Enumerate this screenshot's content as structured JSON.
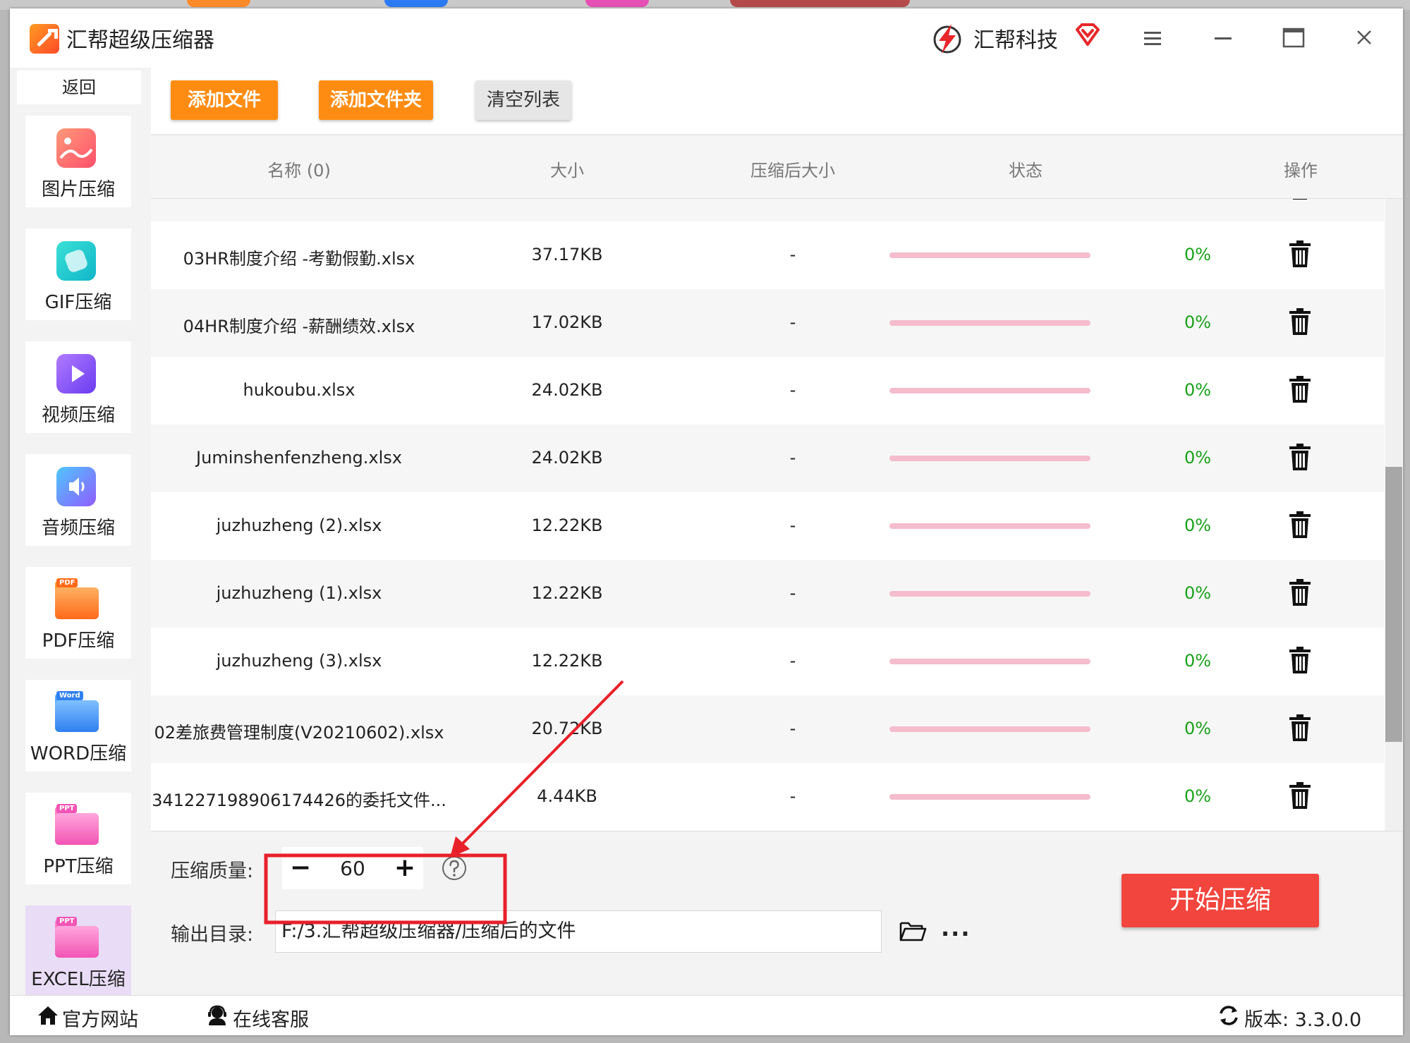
{
  "app": {
    "title": "汇帮超级压缩器",
    "brand_name": "汇帮科技"
  },
  "sidebar": {
    "back_label": "返回",
    "items": [
      {
        "label": "图片压缩",
        "icon": "image-icon"
      },
      {
        "label": "GIF压缩",
        "icon": "gif-icon"
      },
      {
        "label": "视频压缩",
        "icon": "video-icon"
      },
      {
        "label": "音频压缩",
        "icon": "audio-icon"
      },
      {
        "label": "PDF压缩",
        "icon": "pdf-icon",
        "tag": "PDF"
      },
      {
        "label": "WORD压缩",
        "icon": "word-icon",
        "tag": "Word"
      },
      {
        "label": "PPT压缩",
        "icon": "ppt-icon",
        "tag": "PPT"
      },
      {
        "label": "EXCEL压缩",
        "icon": "excel-icon",
        "tag": "PPT",
        "active": true
      }
    ]
  },
  "toolbar": {
    "add_file": "添加文件",
    "add_folder": "添加文件夹",
    "clear_list": "清空列表"
  },
  "table": {
    "headers": {
      "name": "名称 (0)",
      "size": "大小",
      "compressed_size": "压缩后大小",
      "status": "状态",
      "action": "操作"
    },
    "rows": [
      {
        "name": "03HR制度介绍 -考勤假勤.xlsx",
        "size": "37.17KB",
        "compressed": "-",
        "progress": "0%"
      },
      {
        "name": "04HR制度介绍 -薪酬绩效.xlsx",
        "size": "17.02KB",
        "compressed": "-",
        "progress": "0%"
      },
      {
        "name": "hukoubu.xlsx",
        "size": "24.02KB",
        "compressed": "-",
        "progress": "0%"
      },
      {
        "name": "Juminshenfenzheng.xlsx",
        "size": "24.02KB",
        "compressed": "-",
        "progress": "0%"
      },
      {
        "name": "juzhuzheng (2).xlsx",
        "size": "12.22KB",
        "compressed": "-",
        "progress": "0%"
      },
      {
        "name": "juzhuzheng (1).xlsx",
        "size": "12.22KB",
        "compressed": "-",
        "progress": "0%"
      },
      {
        "name": "juzhuzheng (3).xlsx",
        "size": "12.22KB",
        "compressed": "-",
        "progress": "0%"
      },
      {
        "name": "02差旅费管理制度(V20210602).xlsx",
        "size": "20.72KB",
        "compressed": "-",
        "progress": "0%"
      },
      {
        "name": "341227198906174426的委托文件...",
        "size": "4.44KB",
        "compressed": "-",
        "progress": "0%"
      }
    ]
  },
  "settings": {
    "quality_label": "压缩质量:",
    "quality_value": "60",
    "minus": "−",
    "plus": "+",
    "output_label": "输出目录:",
    "output_path": "F:/3.汇帮超级压缩器/压缩后的文件",
    "more": "···",
    "start_button": "开始压缩"
  },
  "statusbar": {
    "website": "官方网站",
    "support": "在线客服",
    "version": "版本:  3.3.0.0"
  },
  "colors": {
    "accent_orange": "#ff8c12",
    "start_red": "#f2453d",
    "progress_pink": "#f4bccd",
    "percent_green": "#1aa11a",
    "annotation_red": "#e8202a",
    "sidebar_active": "#e9dcf6"
  }
}
